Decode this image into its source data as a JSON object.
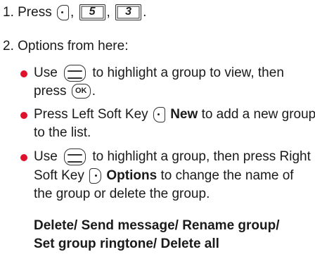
{
  "step1": {
    "prefix": "1. Press",
    "sep1": ",",
    "sep2": ",",
    "end": ".",
    "key_left_soft": "left-soft-key-icon",
    "key_5": "5",
    "key_3": "3"
  },
  "step2": {
    "heading": "2. Options from here:"
  },
  "bullets": [
    {
      "icon_nav": "navigation-key-icon",
      "line1_a": "Use",
      "line1_b": "to highlight a group to view, then",
      "line2_a": "press",
      "icon_ok": "ok-key-icon",
      "line2_b": "."
    },
    {
      "line1_a": "Press Left Soft Key",
      "icon_softkey": "left-soft-key-icon",
      "bold": "New",
      "line1_b": "to add a new group",
      "line2": "to the list."
    },
    {
      "line1_a": "Use",
      "icon_nav": "navigation-key-icon",
      "line1_b": "to highlight a group, then press Right",
      "line2_a": "Soft Key",
      "icon_softkey": "right-soft-key-icon",
      "bold": "Options",
      "line2_b": "to change the name of",
      "line3": "the group or delete the group."
    }
  ],
  "options_list": {
    "line1": "Delete/ Send message/ Rename group/",
    "line2": "Set group ringtone/ Delete all"
  },
  "colors": {
    "bullet": "#e0122b",
    "text": "#1a1a1a"
  }
}
